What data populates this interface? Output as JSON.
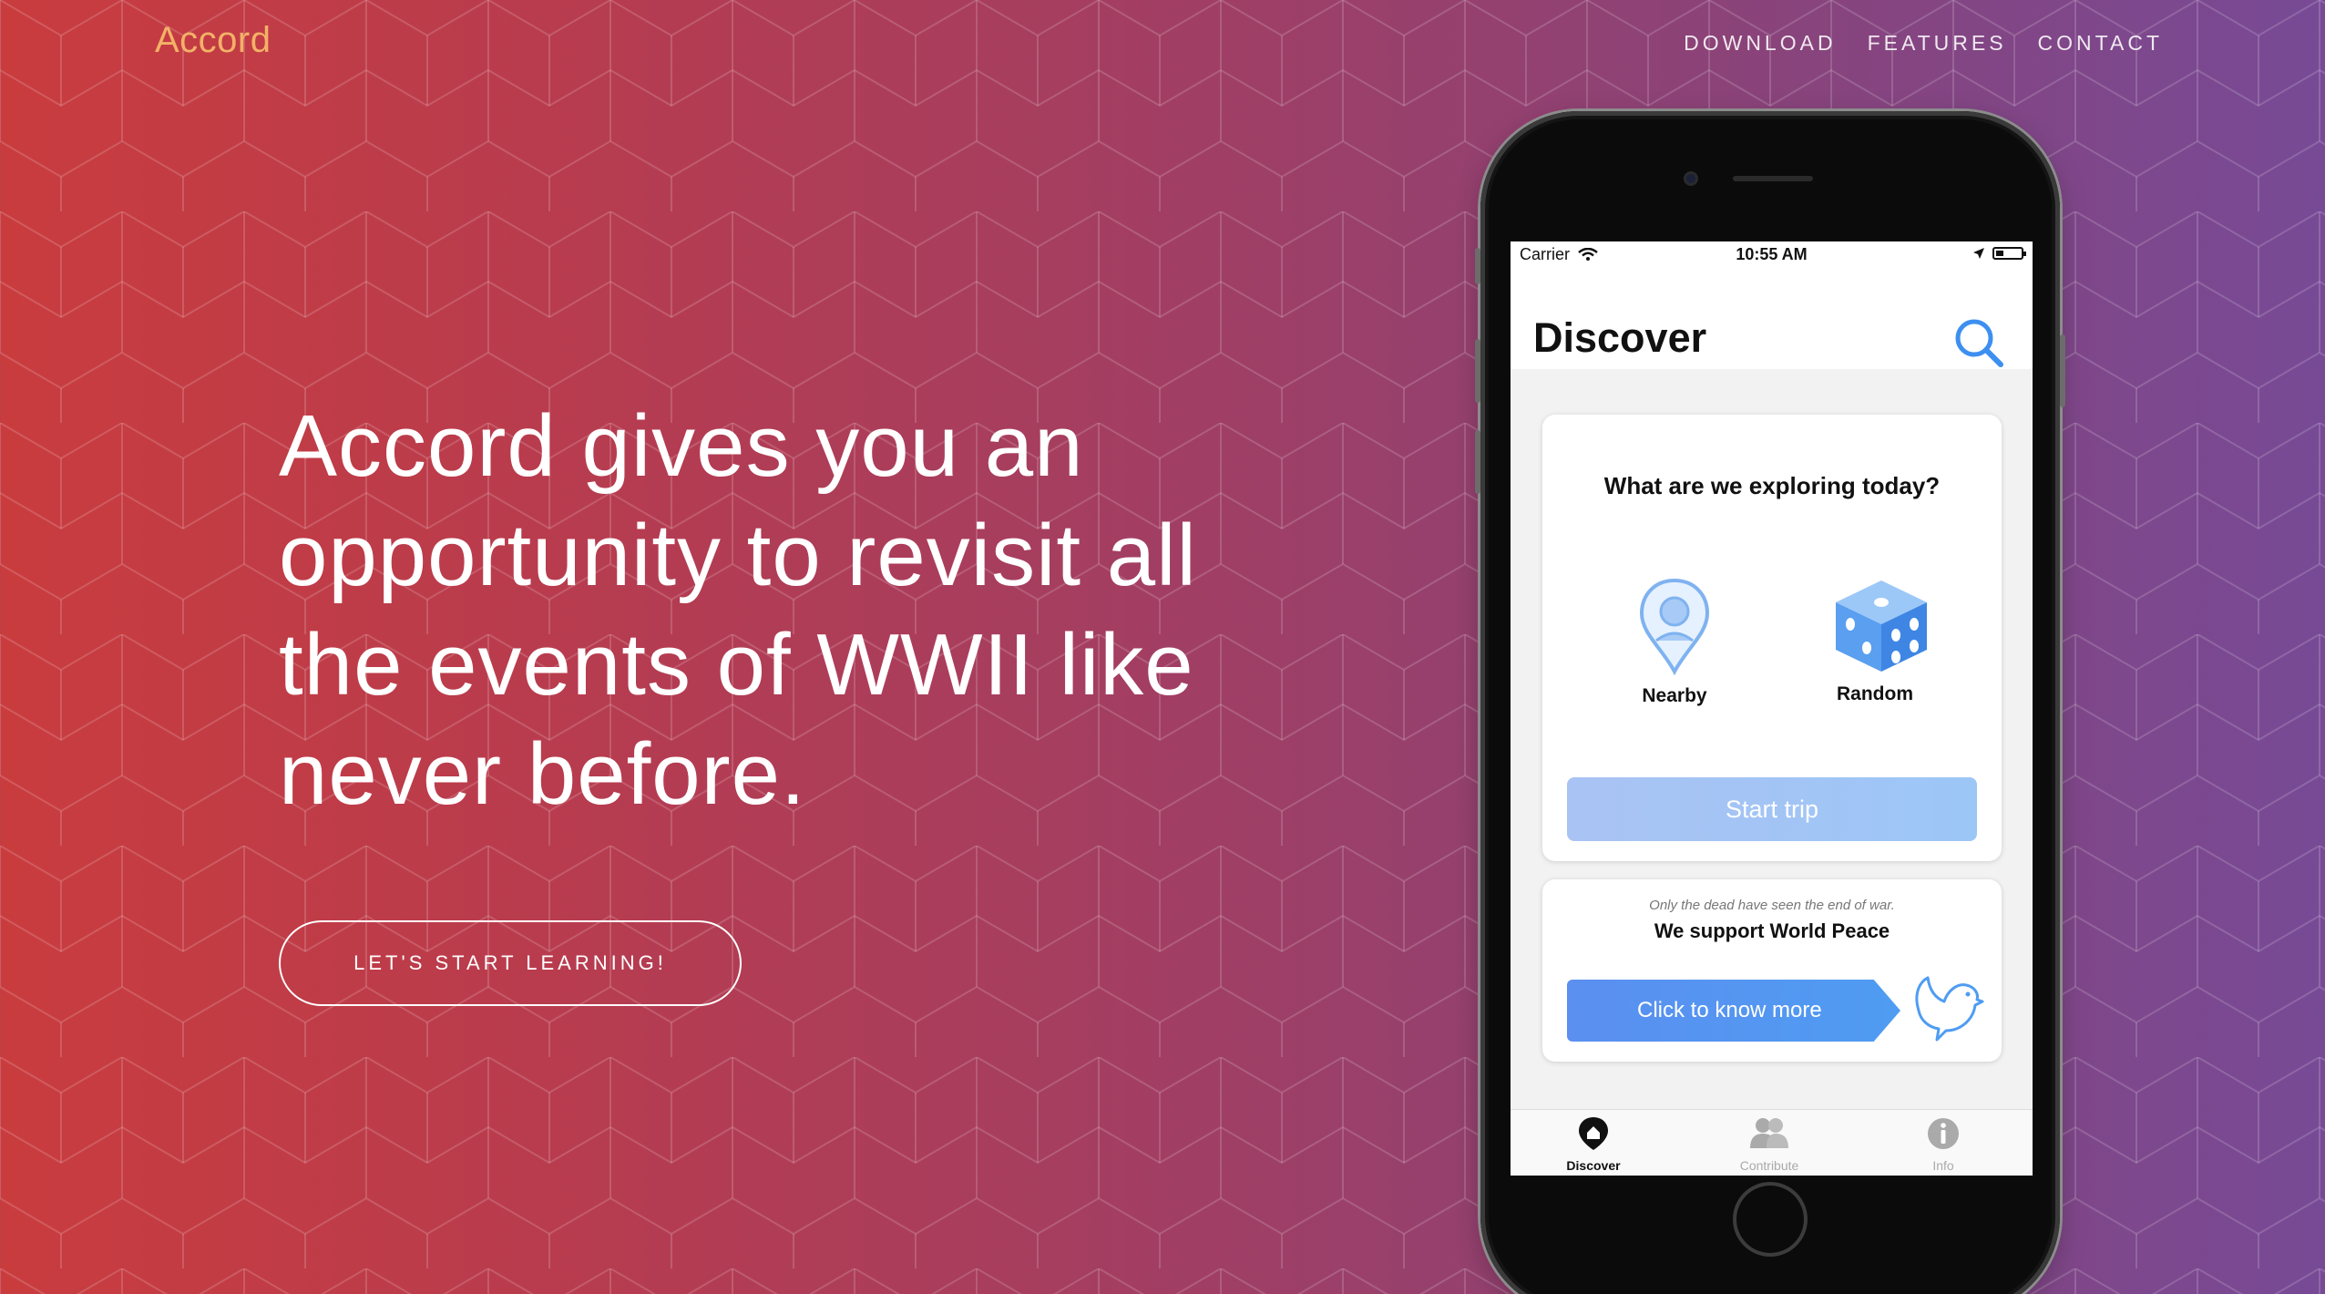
{
  "nav": {
    "brand": "Accord",
    "links": [
      "DOWNLOAD",
      "FEATURES",
      "CONTACT"
    ]
  },
  "hero": {
    "line1": "Accord gives you an",
    "line2": "opportunity to revisit all",
    "line3_prefix": "the events of ",
    "line3_emphasis": "WWII",
    "line3_suffix": " like",
    "line4": "never before.",
    "cta": "LET'S START LEARNING!"
  },
  "phone": {
    "status": {
      "carrier": "Carrier",
      "time": "10:55 AM"
    },
    "title": "Discover",
    "question": "What are we exploring today?",
    "options": [
      {
        "label": "Nearby",
        "icon": "map-pin-icon"
      },
      {
        "label": "Random",
        "icon": "dice-icon"
      }
    ],
    "start_button": "Start trip",
    "quote": "Only the dead have seen the end of war.",
    "support": "We support World Peace",
    "know_button": "Click to know more",
    "tabs": [
      {
        "label": "Discover",
        "icon": "discover-icon",
        "active": true
      },
      {
        "label": "Contribute",
        "icon": "contribute-icon",
        "active": false
      },
      {
        "label": "Info",
        "icon": "info-icon",
        "active": false
      }
    ]
  },
  "colors": {
    "gradient_left": "#c93c3e",
    "gradient_right": "#774a96",
    "brand": "#f3b168",
    "accent_blue": "#4f9cf2"
  }
}
